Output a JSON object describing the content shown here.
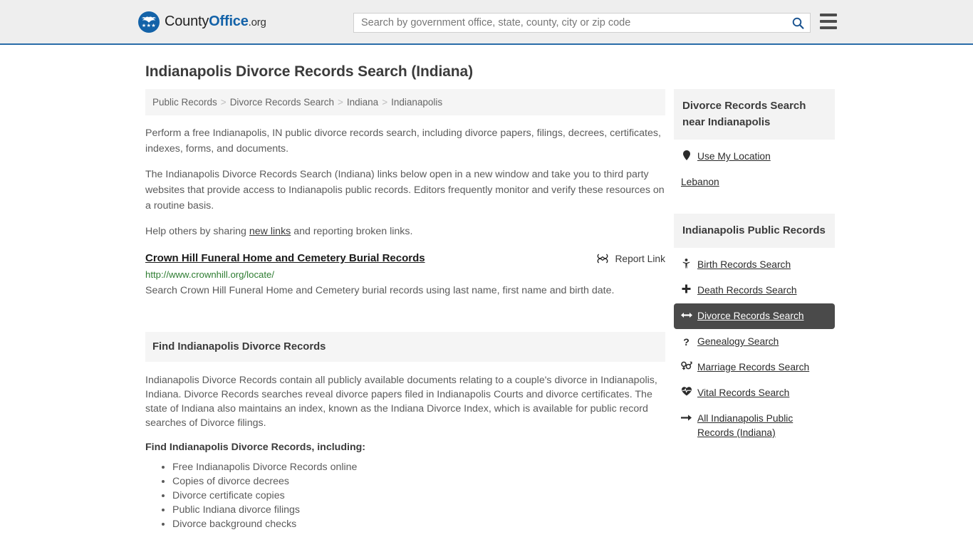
{
  "header": {
    "logo": {
      "part1": "County",
      "part2": "Office",
      "part3": ".org",
      "icon": "eagle-seal-icon"
    },
    "search": {
      "placeholder": "Search by government office, state, county, city or zip code",
      "value": "",
      "button_icon": "search-icon"
    },
    "menu_icon": "hamburger-menu-icon",
    "accent_color": "#2a6ca8",
    "background_color": "#eeeeee"
  },
  "main": {
    "title": "Indianapolis Divorce Records Search (Indiana)",
    "breadcrumb": [
      {
        "label": "Public Records"
      },
      {
        "label": "Divorce Records Search"
      },
      {
        "label": "Indiana"
      },
      {
        "label": "Indianapolis"
      }
    ],
    "breadcrumb_separator": ">",
    "intro_paragraph": "Perform a free Indianapolis, IN public divorce records search, including divorce papers, filings, decrees, certificates, indexes, forms, and documents.",
    "description_paragraph": "The Indianapolis Divorce Records Search (Indiana) links below open in a new window and take you to third party websites that provide access to Indianapolis public records. Editors frequently monitor and verify these resources on a routine basis.",
    "help_prefix": "Help others by sharing ",
    "help_link": "new links",
    "help_suffix": " and reporting broken links.",
    "result": {
      "title": "Crown Hill Funeral Home and Cemetery Burial Records",
      "url": "http://www.crownhill.org/locate/",
      "description": "Search Crown Hill Funeral Home and Cemetery burial records using last name, first name and birth date.",
      "report_label": "Report Link",
      "report_icon": "broken-link-icon",
      "url_color": "#2e7d32"
    },
    "section": {
      "heading": "Find Indianapolis Divorce Records",
      "body": "Indianapolis Divorce Records contain all publicly available documents relating to a couple's divorce in Indianapolis, Indiana. Divorce Records searches reveal divorce papers filed in Indianapolis Courts and divorce certificates. The state of Indiana also maintains an index, known as the Indiana Divorce Index, which is available for public record searches of Divorce filings.",
      "subheading": "Find Indianapolis Divorce Records, including:",
      "bullets": [
        "Free Indianapolis Divorce Records online",
        "Copies of divorce decrees",
        "Divorce certificate copies",
        "Public Indiana divorce filings",
        "Divorce background checks"
      ]
    }
  },
  "sidebar": {
    "nearby": {
      "heading": "Divorce Records Search near Indianapolis",
      "items": [
        {
          "label": "Use My Location",
          "icon": "map-pin-icon",
          "active": false
        },
        {
          "label": "Lebanon",
          "icon": "",
          "active": false
        }
      ]
    },
    "public_records": {
      "heading": "Indianapolis Public Records",
      "items": [
        {
          "label": "Birth Records Search",
          "icon": "baby-icon",
          "active": false
        },
        {
          "label": "Death Records Search",
          "icon": "cross-icon",
          "active": false
        },
        {
          "label": "Divorce Records Search",
          "icon": "arrows-left-right-icon",
          "active": true
        },
        {
          "label": "Genealogy Search",
          "icon": "question-mark-icon",
          "active": false
        },
        {
          "label": "Marriage Records Search",
          "icon": "venus-mars-icon",
          "active": false
        },
        {
          "label": "Vital Records Search",
          "icon": "heartbeat-icon",
          "active": false
        },
        {
          "label": "All Indianapolis Public Records (Indiana)",
          "icon": "arrow-right-icon",
          "active": false
        }
      ],
      "active_background": "#4a4a4a"
    }
  }
}
